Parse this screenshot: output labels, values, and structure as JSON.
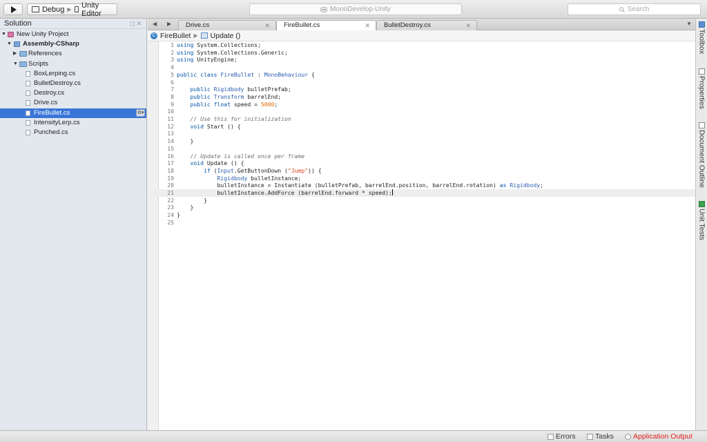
{
  "toolbar": {
    "configuration": "Debug",
    "target": "Unity Editor",
    "status_text": "MonoDevelop-Unity",
    "search_placeholder": "Search"
  },
  "solution_pad": {
    "title": "Solution",
    "tree": {
      "project": "New Unity Project",
      "assembly": "Assembly-CSharp",
      "references": "References",
      "scripts_folder": "Scripts",
      "files": [
        "BoxLerping.cs",
        "BulletDestroy.cs",
        "Destroy.cs",
        "Drive.cs",
        "FireBullet.cs",
        "IntensityLerp.cs",
        "Punched.cs"
      ],
      "selected_file": "FireBullet.cs"
    }
  },
  "editor": {
    "tabs": [
      {
        "label": "Drive.cs",
        "active": false
      },
      {
        "label": "FireBullet.cs",
        "active": true
      },
      {
        "label": "BulletDestroy.cs",
        "active": false
      }
    ],
    "breadcrumb": {
      "class_name": "FireBullet",
      "method_name": "Update ()"
    },
    "current_line": 21,
    "code_lines": [
      [
        {
          "k": "k",
          "v": "using"
        },
        {
          "v": " System.Collections;"
        }
      ],
      [
        {
          "k": "k",
          "v": "using"
        },
        {
          "v": " System.Collections.Generic;"
        }
      ],
      [
        {
          "k": "k",
          "v": "using"
        },
        {
          "v": " UnityEngine;"
        }
      ],
      [],
      [
        {
          "k": "k",
          "v": "public class"
        },
        {
          "v": " "
        },
        {
          "k": "t",
          "v": "FireBullet"
        },
        {
          "v": " : "
        },
        {
          "k": "t",
          "v": "MonoBehaviour"
        },
        {
          "v": " {"
        }
      ],
      [],
      [
        {
          "v": "    "
        },
        {
          "k": "k",
          "v": "public"
        },
        {
          "v": " "
        },
        {
          "k": "t",
          "v": "Rigidbody"
        },
        {
          "v": " bulletPrefab;"
        }
      ],
      [
        {
          "v": "    "
        },
        {
          "k": "k",
          "v": "public"
        },
        {
          "v": " "
        },
        {
          "k": "t",
          "v": "Transform"
        },
        {
          "v": " barrelEnd;"
        }
      ],
      [
        {
          "v": "    "
        },
        {
          "k": "k",
          "v": "public float"
        },
        {
          "v": " speed = "
        },
        {
          "k": "n",
          "v": "5000"
        },
        {
          "v": ";"
        }
      ],
      [],
      [
        {
          "v": "    "
        },
        {
          "k": "c",
          "v": "// Use this for initialization"
        }
      ],
      [
        {
          "v": "    "
        },
        {
          "k": "k",
          "v": "void"
        },
        {
          "v": " Start () {"
        }
      ],
      [],
      [
        {
          "v": "    }"
        }
      ],
      [],
      [
        {
          "v": "    "
        },
        {
          "k": "c",
          "v": "// Update is called once per frame"
        }
      ],
      [
        {
          "v": "    "
        },
        {
          "k": "k",
          "v": "void"
        },
        {
          "v": " Update () {"
        }
      ],
      [
        {
          "v": "        "
        },
        {
          "k": "k",
          "v": "if"
        },
        {
          "v": " ("
        },
        {
          "k": "t",
          "v": "Input"
        },
        {
          "v": ".GetButtonDown ("
        },
        {
          "k": "s",
          "v": "\"Jump\""
        },
        {
          "v": ")) {"
        }
      ],
      [
        {
          "v": "            "
        },
        {
          "k": "t",
          "v": "Rigidbody"
        },
        {
          "v": " bulletInstance;"
        }
      ],
      [
        {
          "v": "            bulletInstance = Instantiate (bulletPrefab, barrelEnd.position, barrelEnd.rotation) "
        },
        {
          "k": "k",
          "v": "as"
        },
        {
          "v": " "
        },
        {
          "k": "t",
          "v": "Rigidbody"
        },
        {
          "v": ";"
        }
      ],
      [
        {
          "v": "            bulletInstance.AddForce (barrelEnd.forward * speed);"
        }
      ],
      [
        {
          "v": "        }"
        }
      ],
      [
        {
          "v": "    }"
        }
      ],
      [
        {
          "v": "}"
        }
      ],
      []
    ]
  },
  "right_dock": [
    "Toolbox",
    "Properties",
    "Document Outline",
    "Unit Tests"
  ],
  "bottom_bar": {
    "errors_label": "Errors",
    "tasks_label": "Tasks",
    "app_output_label": "Application Output",
    "app_output_color": "#e0201b"
  },
  "colors": {
    "selection": "#3a76d8",
    "keyword": "#0055a8",
    "type": "#2a5db0",
    "comment": "#6d6d6d",
    "string": "#d43f1a",
    "number": "#e06c00"
  }
}
